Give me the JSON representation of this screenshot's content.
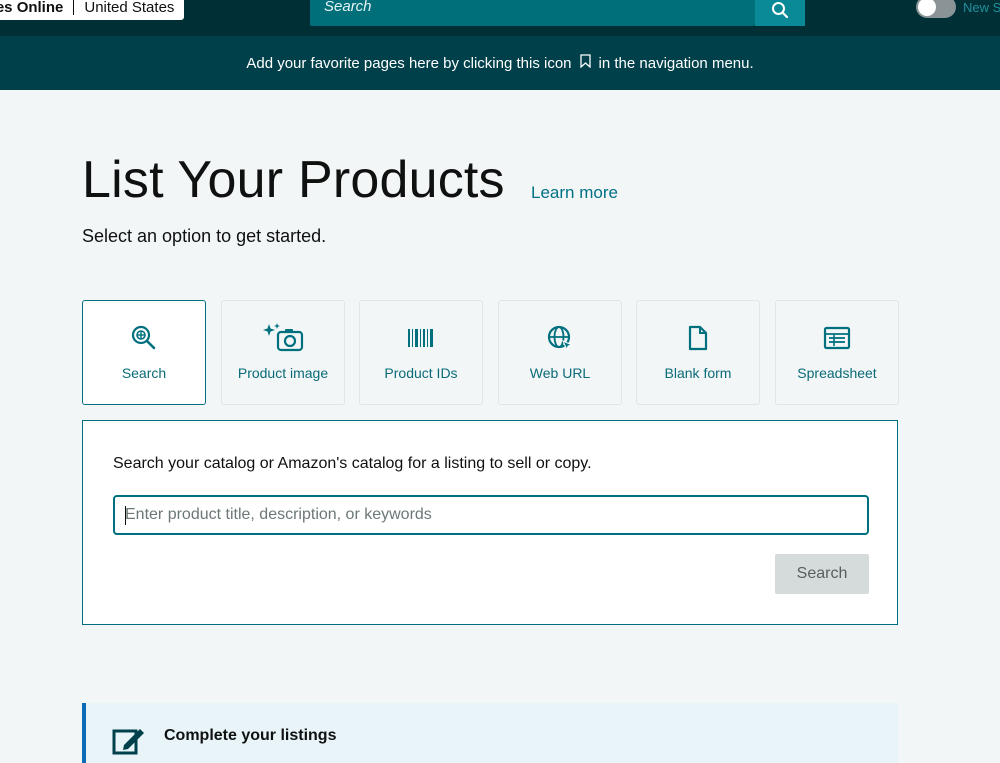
{
  "topnav": {
    "store_name": "res Online",
    "country": "United States",
    "search_placeholder": "Search",
    "new_label": "New S"
  },
  "favorites_bar": {
    "text_before": "Add your favorite pages here by clicking this icon",
    "text_after": "in the navigation menu."
  },
  "main": {
    "title": "List Your Products",
    "learn_more": "Learn more",
    "subtitle": "Select an option to get started."
  },
  "options": [
    {
      "label": "Search",
      "icon": "search-catalog-icon",
      "active": true
    },
    {
      "label": "Product image",
      "icon": "camera-sparkle-icon",
      "active": false
    },
    {
      "label": "Product IDs",
      "icon": "barcode-icon",
      "active": false
    },
    {
      "label": "Web URL",
      "icon": "globe-icon",
      "active": false
    },
    {
      "label": "Blank form",
      "icon": "document-icon",
      "active": false
    },
    {
      "label": "Spreadsheet",
      "icon": "spreadsheet-icon",
      "active": false
    }
  ],
  "search_panel": {
    "description": "Search your catalog or Amazon's catalog for a listing to sell or copy.",
    "input_placeholder": "Enter product title, description, or keywords",
    "button_label": "Search"
  },
  "complete_listings": {
    "title": "Complete your listings"
  },
  "colors": {
    "nav_dark": "#002f36",
    "fav_bar": "#00404a",
    "accent_teal": "#00707f",
    "link": "#007185"
  }
}
